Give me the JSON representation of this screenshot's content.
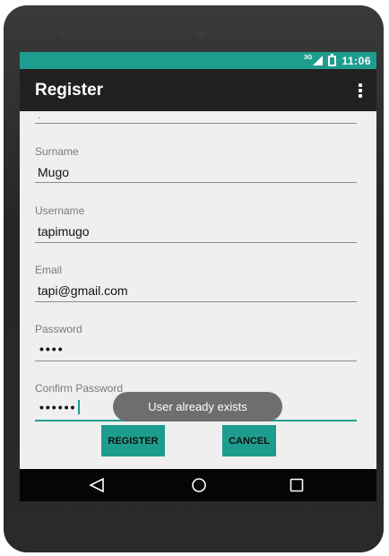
{
  "status_bar": {
    "network": "3G",
    "time": "11:06"
  },
  "app_bar": {
    "title": "Register"
  },
  "form": {
    "top_field_value": "·",
    "surname": {
      "label": "Surname",
      "value": "Mugo"
    },
    "username": {
      "label": "Username",
      "value": "tapimugo"
    },
    "email": {
      "label": "Email",
      "value": "tapi@gmail.com"
    },
    "password": {
      "label": "Password",
      "value": "••••"
    },
    "confirm_password": {
      "label": "Confirm Password",
      "value": "••••••"
    }
  },
  "toast": {
    "message": "User already exists"
  },
  "buttons": {
    "register": "REGISTER",
    "cancel": "CANCEL"
  },
  "nav": {
    "icons": [
      "back-icon",
      "home-icon",
      "recent-apps-icon"
    ]
  },
  "colors": {
    "accent": "#1e9d8e",
    "app_bar": "#212121",
    "background": "#efefef",
    "toast": "#6e6e6e"
  }
}
